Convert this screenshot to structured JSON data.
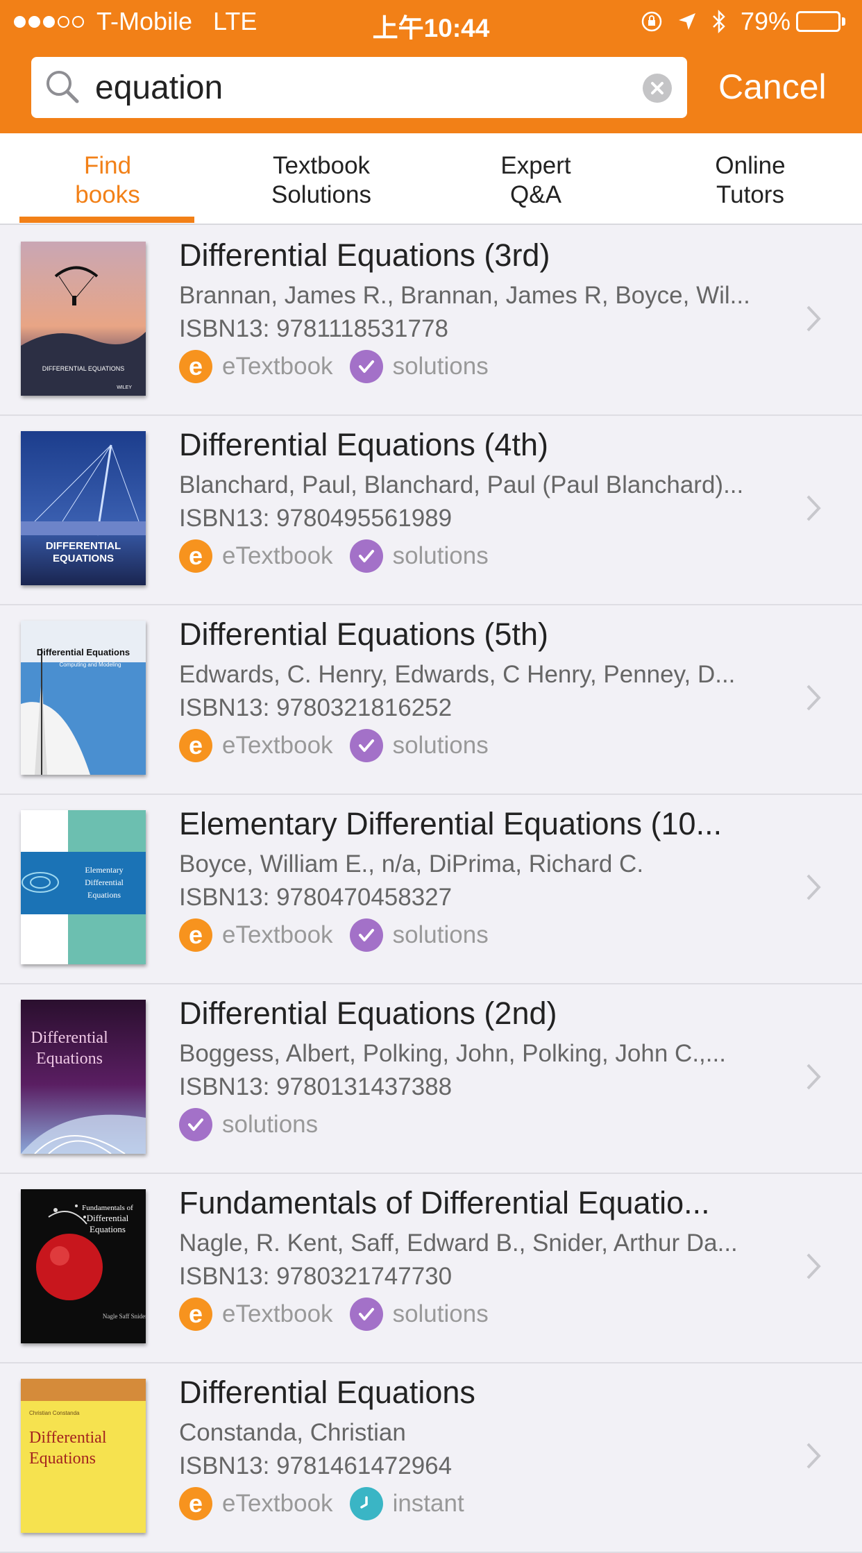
{
  "status_bar": {
    "carrier": "T-Mobile",
    "network": "LTE",
    "time": "上午10:44",
    "battery": "79%",
    "battery_level": 0.79
  },
  "search": {
    "value": "equation",
    "cancel_label": "Cancel"
  },
  "tabs": [
    {
      "label": "Find\nbooks",
      "active": true
    },
    {
      "label": "Textbook\nSolutions",
      "active": false
    },
    {
      "label": "Expert\nQ&A",
      "active": false
    },
    {
      "label": "Online\nTutors",
      "active": false
    }
  ],
  "books": [
    {
      "title": "Differential Equations (3rd)",
      "authors": "Brannan, James R., Brannan, James R, Boyce, Wil...",
      "isbn": "ISBN13: 9781118531778",
      "etextbook_label": "eTextbook",
      "solutions_label": "solutions",
      "cover_text": "DIFFERENTIAL EQUATIONS",
      "cover_publisher": "WILEY"
    },
    {
      "title": "Differential Equations (4th)",
      "authors": "Blanchard, Paul, Blanchard, Paul (Paul Blanchard)...",
      "isbn": "ISBN13: 9780495561989",
      "etextbook_label": "eTextbook",
      "solutions_label": "solutions",
      "cover_text": "DIFFERENTIAL",
      "cover_text2": "EQUATIONS"
    },
    {
      "title": "Differential Equations (5th)",
      "authors": "Edwards, C. Henry, Edwards, C Henry, Penney, D...",
      "isbn": "ISBN13: 9780321816252",
      "etextbook_label": "eTextbook",
      "solutions_label": "solutions",
      "cover_text": "Differential Equations",
      "cover_subtext": "Computing and Modeling"
    },
    {
      "title": "Elementary Differential Equations (10...",
      "authors": "Boyce, William E., n/a, DiPrima, Richard C.",
      "isbn": "ISBN13: 9780470458327",
      "etextbook_label": "eTextbook",
      "solutions_label": "solutions",
      "cover_text": "Elementary",
      "cover_text2": "Differential",
      "cover_text3": "Equations"
    },
    {
      "title": "Differential Equations (2nd)",
      "authors": "Boggess, Albert, Polking, John, Polking, John C.,...",
      "isbn": "ISBN13: 9780131437388",
      "solutions_label": "solutions",
      "cover_text": "Differential",
      "cover_text2": "Equations"
    },
    {
      "title": "Fundamentals of Differential Equatio...",
      "authors": "Nagle, R. Kent, Saff, Edward B., Snider, Arthur Da...",
      "isbn": "ISBN13: 9780321747730",
      "etextbook_label": "eTextbook",
      "solutions_label": "solutions",
      "cover_text": "Fundamentals of",
      "cover_text2": "Differential",
      "cover_text3": "Equations",
      "cover_authors": "Nagle Saff Snider"
    },
    {
      "title": "Differential Equations",
      "authors": "Constanda, Christian",
      "isbn": "ISBN13: 9781461472964",
      "etextbook_label": "eTextbook",
      "instant_label": "instant",
      "cover_text": "Differential",
      "cover_text2": "Equations",
      "cover_author": "Christian Constanda"
    }
  ],
  "colors": {
    "brand_orange": "#f28017",
    "etextbook_badge": "#f7931e",
    "solutions_badge": "#a371c8",
    "instant_badge": "#3ab5c5"
  }
}
